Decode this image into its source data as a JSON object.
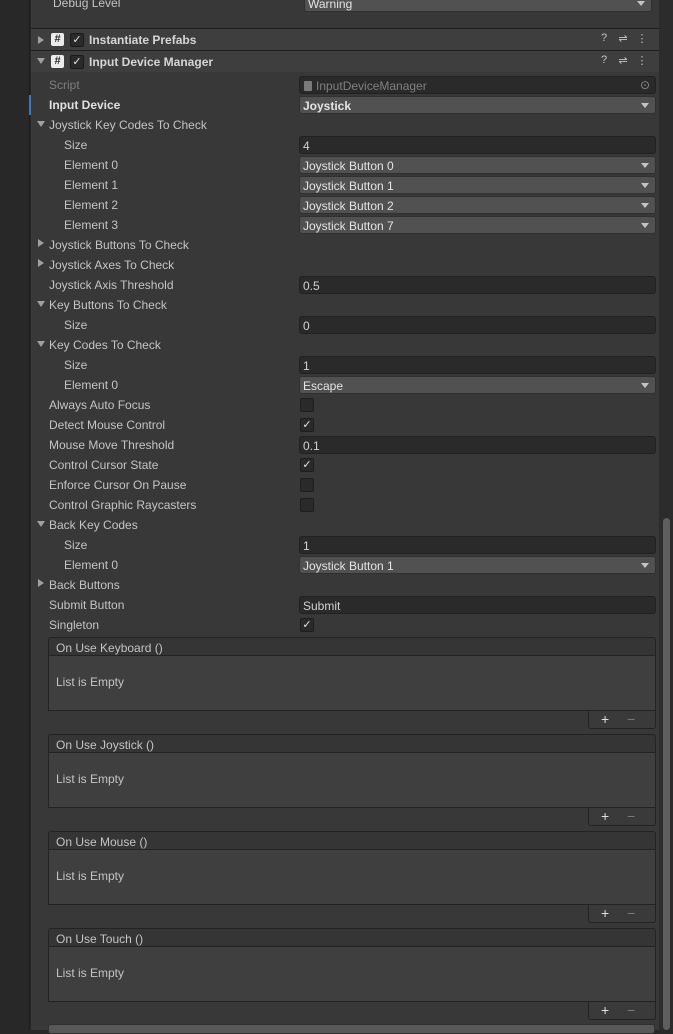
{
  "debug_level": {
    "label": "Debug Level",
    "value": "Warning"
  },
  "components": {
    "instantiate_prefabs": {
      "title": "Instantiate Prefabs"
    },
    "input_device_manager": {
      "title": "Input Device Manager"
    }
  },
  "icons": {
    "hash": "#",
    "check": "✓",
    "help": "?",
    "settings": "⇌",
    "more": "⋮",
    "plus": "+",
    "minus": "−",
    "object": "⊙"
  },
  "fields": {
    "script": {
      "label": "Script",
      "value": "InputDeviceManager"
    },
    "input_device": {
      "label": "Input Device",
      "value": "Joystick"
    },
    "joystick_key_codes": {
      "label": "Joystick Key Codes To Check",
      "size_label": "Size",
      "size": "4",
      "elements": [
        {
          "label": "Element 0",
          "value": "Joystick Button 0"
        },
        {
          "label": "Element 1",
          "value": "Joystick Button 1"
        },
        {
          "label": "Element 2",
          "value": "Joystick Button 2"
        },
        {
          "label": "Element 3",
          "value": "Joystick Button 7"
        }
      ]
    },
    "joystick_buttons": {
      "label": "Joystick Buttons To Check"
    },
    "joystick_axes": {
      "label": "Joystick Axes To Check"
    },
    "joystick_axis_threshold": {
      "label": "Joystick Axis Threshold",
      "value": "0.5"
    },
    "key_buttons": {
      "label": "Key Buttons To Check",
      "size_label": "Size",
      "size": "0"
    },
    "key_codes": {
      "label": "Key Codes To Check",
      "size_label": "Size",
      "size": "1",
      "elements": [
        {
          "label": "Element 0",
          "value": "Escape"
        }
      ]
    },
    "always_auto_focus": {
      "label": "Always Auto Focus",
      "checked": false
    },
    "detect_mouse_control": {
      "label": "Detect Mouse Control",
      "checked": true
    },
    "mouse_move_threshold": {
      "label": "Mouse Move Threshold",
      "value": "0.1"
    },
    "control_cursor_state": {
      "label": "Control Cursor State",
      "checked": true
    },
    "enforce_cursor_on_pause": {
      "label": "Enforce Cursor On Pause",
      "checked": false
    },
    "control_graphic_raycasters": {
      "label": "Control Graphic Raycasters",
      "checked": false
    },
    "back_key_codes": {
      "label": "Back Key Codes",
      "size_label": "Size",
      "size": "1",
      "elements": [
        {
          "label": "Element 0",
          "value": "Joystick Button 1"
        }
      ]
    },
    "back_buttons": {
      "label": "Back Buttons"
    },
    "submit_button": {
      "label": "Submit Button",
      "value": "Submit"
    },
    "singleton": {
      "label": "Singleton",
      "checked": true
    }
  },
  "events": [
    {
      "title": "On Use Keyboard ()",
      "empty": "List is Empty"
    },
    {
      "title": "On Use Joystick ()",
      "empty": "List is Empty"
    },
    {
      "title": "On Use Mouse ()",
      "empty": "List is Empty"
    },
    {
      "title": "On Use Touch ()",
      "empty": "List is Empty"
    }
  ],
  "colors": {
    "panel": "#383838",
    "field": "#2a2a2a",
    "dropdown": "#515151",
    "selection": "#3a79bb"
  }
}
